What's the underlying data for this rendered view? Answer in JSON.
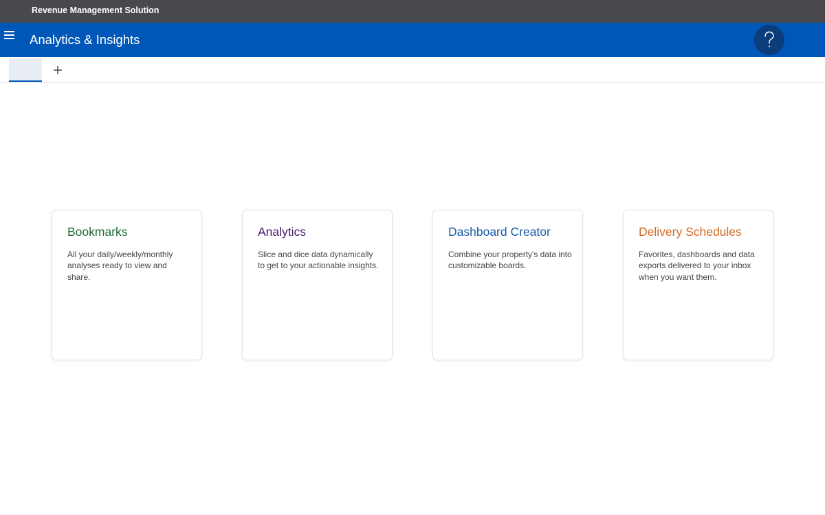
{
  "app": {
    "title": "Revenue Management Solution"
  },
  "header": {
    "title": "Analytics & Insights",
    "menu_icon": "hamburger-menu-icon",
    "help_icon": "question-mark-icon",
    "background": "#0157b8"
  },
  "tabs": {
    "add_icon": "plus-icon"
  },
  "cards": [
    {
      "title": "Bookmarks",
      "description": "All your daily/weekly/monthly analyses ready to view and share.",
      "color": "#1e6b3a"
    },
    {
      "title": "Analytics",
      "description": "Slice and dice data dynamically to get to your actionable insights.",
      "color": "#4b1c6e"
    },
    {
      "title": "Dashboard Creator",
      "description": "Combine your property's data into customizable boards.",
      "color": "#1a5cab"
    },
    {
      "title": "Delivery Schedules",
      "description": "Favorites, dashboards and data exports delivered to your inbox when you want them.",
      "color": "#d2691e"
    }
  ]
}
